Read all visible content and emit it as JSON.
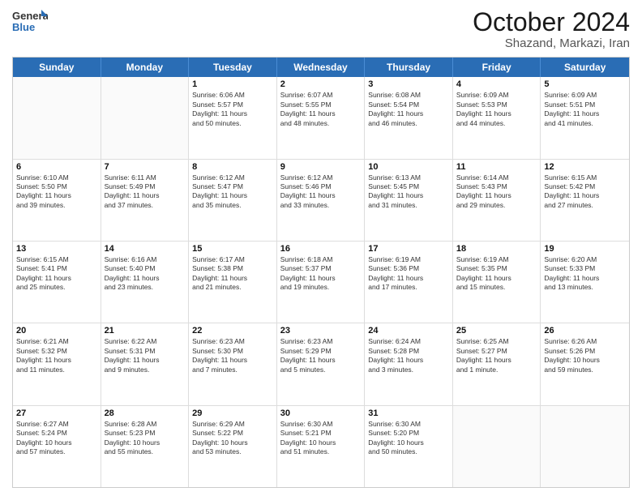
{
  "header": {
    "logo_general": "General",
    "logo_blue": "Blue",
    "month_title": "October 2024",
    "subtitle": "Shazand, Markazi, Iran"
  },
  "days_of_week": [
    "Sunday",
    "Monday",
    "Tuesday",
    "Wednesday",
    "Thursday",
    "Friday",
    "Saturday"
  ],
  "weeks": [
    [
      {
        "day": "",
        "lines": []
      },
      {
        "day": "",
        "lines": []
      },
      {
        "day": "1",
        "lines": [
          "Sunrise: 6:06 AM",
          "Sunset: 5:57 PM",
          "Daylight: 11 hours",
          "and 50 minutes."
        ]
      },
      {
        "day": "2",
        "lines": [
          "Sunrise: 6:07 AM",
          "Sunset: 5:55 PM",
          "Daylight: 11 hours",
          "and 48 minutes."
        ]
      },
      {
        "day": "3",
        "lines": [
          "Sunrise: 6:08 AM",
          "Sunset: 5:54 PM",
          "Daylight: 11 hours",
          "and 46 minutes."
        ]
      },
      {
        "day": "4",
        "lines": [
          "Sunrise: 6:09 AM",
          "Sunset: 5:53 PM",
          "Daylight: 11 hours",
          "and 44 minutes."
        ]
      },
      {
        "day": "5",
        "lines": [
          "Sunrise: 6:09 AM",
          "Sunset: 5:51 PM",
          "Daylight: 11 hours",
          "and 41 minutes."
        ]
      }
    ],
    [
      {
        "day": "6",
        "lines": [
          "Sunrise: 6:10 AM",
          "Sunset: 5:50 PM",
          "Daylight: 11 hours",
          "and 39 minutes."
        ]
      },
      {
        "day": "7",
        "lines": [
          "Sunrise: 6:11 AM",
          "Sunset: 5:49 PM",
          "Daylight: 11 hours",
          "and 37 minutes."
        ]
      },
      {
        "day": "8",
        "lines": [
          "Sunrise: 6:12 AM",
          "Sunset: 5:47 PM",
          "Daylight: 11 hours",
          "and 35 minutes."
        ]
      },
      {
        "day": "9",
        "lines": [
          "Sunrise: 6:12 AM",
          "Sunset: 5:46 PM",
          "Daylight: 11 hours",
          "and 33 minutes."
        ]
      },
      {
        "day": "10",
        "lines": [
          "Sunrise: 6:13 AM",
          "Sunset: 5:45 PM",
          "Daylight: 11 hours",
          "and 31 minutes."
        ]
      },
      {
        "day": "11",
        "lines": [
          "Sunrise: 6:14 AM",
          "Sunset: 5:43 PM",
          "Daylight: 11 hours",
          "and 29 minutes."
        ]
      },
      {
        "day": "12",
        "lines": [
          "Sunrise: 6:15 AM",
          "Sunset: 5:42 PM",
          "Daylight: 11 hours",
          "and 27 minutes."
        ]
      }
    ],
    [
      {
        "day": "13",
        "lines": [
          "Sunrise: 6:15 AM",
          "Sunset: 5:41 PM",
          "Daylight: 11 hours",
          "and 25 minutes."
        ]
      },
      {
        "day": "14",
        "lines": [
          "Sunrise: 6:16 AM",
          "Sunset: 5:40 PM",
          "Daylight: 11 hours",
          "and 23 minutes."
        ]
      },
      {
        "day": "15",
        "lines": [
          "Sunrise: 6:17 AM",
          "Sunset: 5:38 PM",
          "Daylight: 11 hours",
          "and 21 minutes."
        ]
      },
      {
        "day": "16",
        "lines": [
          "Sunrise: 6:18 AM",
          "Sunset: 5:37 PM",
          "Daylight: 11 hours",
          "and 19 minutes."
        ]
      },
      {
        "day": "17",
        "lines": [
          "Sunrise: 6:19 AM",
          "Sunset: 5:36 PM",
          "Daylight: 11 hours",
          "and 17 minutes."
        ]
      },
      {
        "day": "18",
        "lines": [
          "Sunrise: 6:19 AM",
          "Sunset: 5:35 PM",
          "Daylight: 11 hours",
          "and 15 minutes."
        ]
      },
      {
        "day": "19",
        "lines": [
          "Sunrise: 6:20 AM",
          "Sunset: 5:33 PM",
          "Daylight: 11 hours",
          "and 13 minutes."
        ]
      }
    ],
    [
      {
        "day": "20",
        "lines": [
          "Sunrise: 6:21 AM",
          "Sunset: 5:32 PM",
          "Daylight: 11 hours",
          "and 11 minutes."
        ]
      },
      {
        "day": "21",
        "lines": [
          "Sunrise: 6:22 AM",
          "Sunset: 5:31 PM",
          "Daylight: 11 hours",
          "and 9 minutes."
        ]
      },
      {
        "day": "22",
        "lines": [
          "Sunrise: 6:23 AM",
          "Sunset: 5:30 PM",
          "Daylight: 11 hours",
          "and 7 minutes."
        ]
      },
      {
        "day": "23",
        "lines": [
          "Sunrise: 6:23 AM",
          "Sunset: 5:29 PM",
          "Daylight: 11 hours",
          "and 5 minutes."
        ]
      },
      {
        "day": "24",
        "lines": [
          "Sunrise: 6:24 AM",
          "Sunset: 5:28 PM",
          "Daylight: 11 hours",
          "and 3 minutes."
        ]
      },
      {
        "day": "25",
        "lines": [
          "Sunrise: 6:25 AM",
          "Sunset: 5:27 PM",
          "Daylight: 11 hours",
          "and 1 minute."
        ]
      },
      {
        "day": "26",
        "lines": [
          "Sunrise: 6:26 AM",
          "Sunset: 5:26 PM",
          "Daylight: 10 hours",
          "and 59 minutes."
        ]
      }
    ],
    [
      {
        "day": "27",
        "lines": [
          "Sunrise: 6:27 AM",
          "Sunset: 5:24 PM",
          "Daylight: 10 hours",
          "and 57 minutes."
        ]
      },
      {
        "day": "28",
        "lines": [
          "Sunrise: 6:28 AM",
          "Sunset: 5:23 PM",
          "Daylight: 10 hours",
          "and 55 minutes."
        ]
      },
      {
        "day": "29",
        "lines": [
          "Sunrise: 6:29 AM",
          "Sunset: 5:22 PM",
          "Daylight: 10 hours",
          "and 53 minutes."
        ]
      },
      {
        "day": "30",
        "lines": [
          "Sunrise: 6:30 AM",
          "Sunset: 5:21 PM",
          "Daylight: 10 hours",
          "and 51 minutes."
        ]
      },
      {
        "day": "31",
        "lines": [
          "Sunrise: 6:30 AM",
          "Sunset: 5:20 PM",
          "Daylight: 10 hours",
          "and 50 minutes."
        ]
      },
      {
        "day": "",
        "lines": []
      },
      {
        "day": "",
        "lines": []
      }
    ]
  ]
}
